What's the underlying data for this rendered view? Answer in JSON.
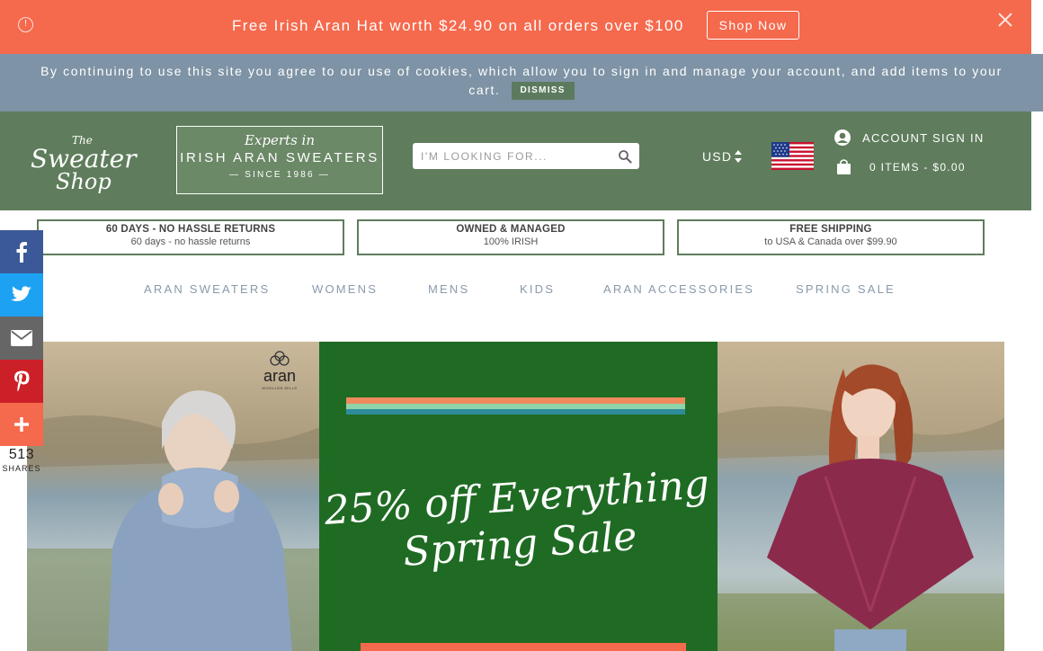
{
  "promo": {
    "text": "Free Irish Aran Hat worth $24.90 on all orders over $100",
    "button": "Shop Now",
    "info_icon": "info-icon",
    "close_icon": "close-icon",
    "bg_color": "#f5694d"
  },
  "cookie": {
    "line1": "By continuing to use this site you agree to our use of cookies, which allow you to sign in and manage your account, and add items to your",
    "line2": "cart.",
    "dismiss": "DISMISS",
    "bg_color": "#7e93a5"
  },
  "header": {
    "logo_line1": "The",
    "logo_line2": "Sweater",
    "logo_line3": "Shop",
    "experts_line1": "Experts in",
    "experts_line2": "IRISH ARAN SWEATERS",
    "experts_line3": "— SINCE 1986 —",
    "search_placeholder": "I'M LOOKING FOR...",
    "currency": "USD",
    "account": "ACCOUNT SIGN IN",
    "cart": "0 ITEMS - $0.00",
    "bg_color": "#5f7d5c"
  },
  "features": [
    {
      "title": "60 DAYS - NO HASSLE RETURNS",
      "sub": "60 days - no hassle returns"
    },
    {
      "title": "OWNED & MANAGED",
      "sub": "100% IRISH"
    },
    {
      "title": "FREE SHIPPING",
      "sub": "to USA & Canada over $99.90"
    }
  ],
  "nav": [
    "ARAN SWEATERS",
    "WOMENS",
    "MENS",
    "KIDS",
    "ARAN ACCESSORIES",
    "SPRING SALE"
  ],
  "social": {
    "count": "513",
    "label": "SHARES",
    "items": [
      {
        "icon": "facebook-icon",
        "color": "#3b5998"
      },
      {
        "icon": "twitter-icon",
        "color": "#1da1f2"
      },
      {
        "icon": "email-icon",
        "color": "#666666"
      },
      {
        "icon": "pinterest-icon",
        "color": "#cb2027"
      },
      {
        "icon": "plus-icon",
        "color": "#f5694d"
      }
    ]
  },
  "hero": {
    "title_line1": "25% off Everything",
    "title_line2": "Spring Sale",
    "aran_logo": "aran",
    "aran_sub": "WOOLLEN MILLS",
    "center_bg": "#1f6b23"
  }
}
